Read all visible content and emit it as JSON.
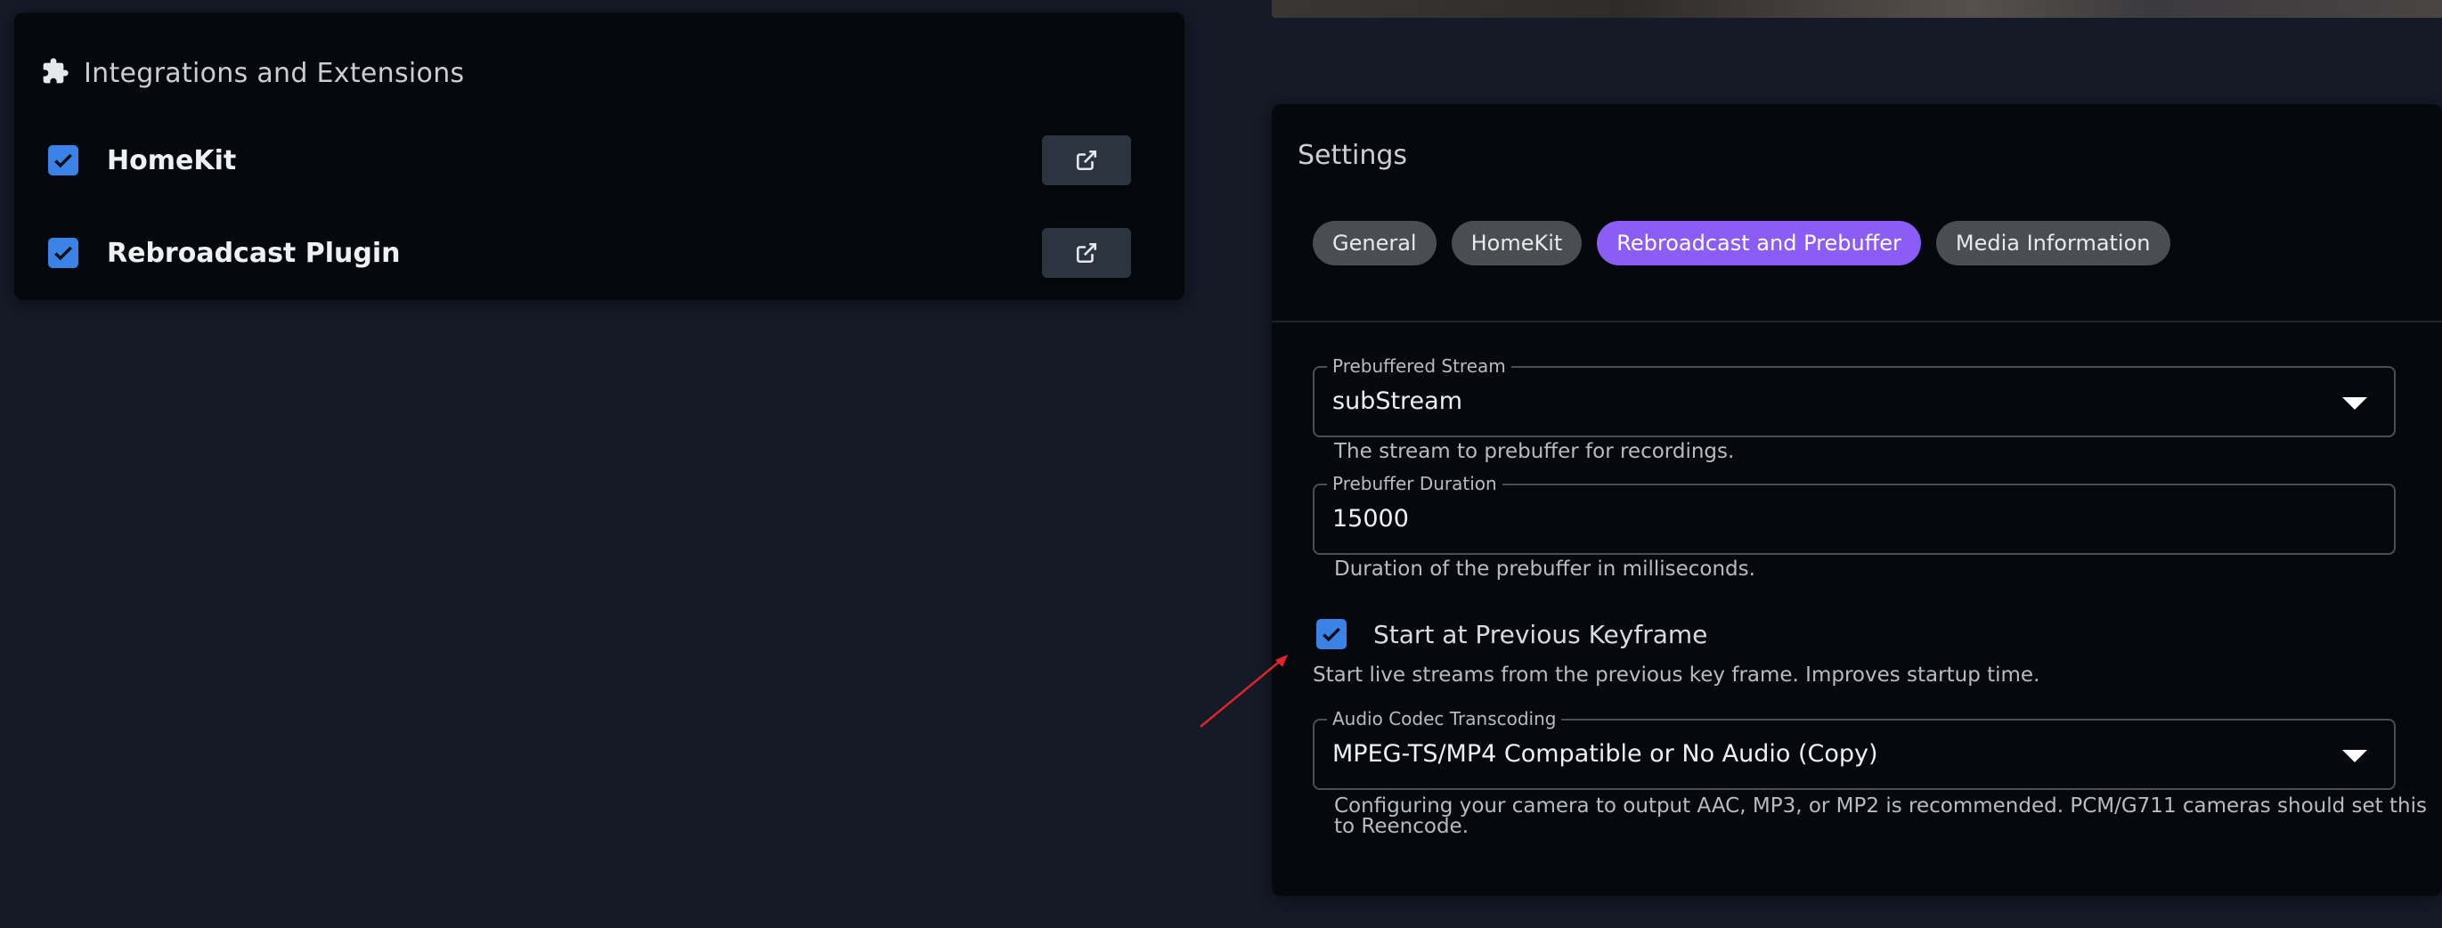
{
  "integrations": {
    "title": "Integrations and Extensions",
    "items": [
      {
        "label": "HomeKit",
        "checked": true
      },
      {
        "label": "Rebroadcast Plugin",
        "checked": true
      }
    ]
  },
  "settings": {
    "title": "Settings",
    "tabs": [
      {
        "label": "General",
        "active": false
      },
      {
        "label": "HomeKit",
        "active": false
      },
      {
        "label": "Rebroadcast and Prebuffer",
        "active": true
      },
      {
        "label": "Media Information",
        "active": false
      }
    ],
    "prebuffered_stream": {
      "legend": "Prebuffered Stream",
      "value": "subStream",
      "helper": "The stream to prebuffer for recordings."
    },
    "prebuffer_duration": {
      "legend": "Prebuffer Duration",
      "value": "15000",
      "helper": "Duration of the prebuffer in milliseconds."
    },
    "keyframe": {
      "label": "Start at Previous Keyframe",
      "checked": true,
      "helper": "Start live streams from the previous key frame. Improves startup time."
    },
    "audio_codec": {
      "legend": "Audio Codec Transcoding",
      "value": "MPEG-TS/MP4 Compatible or No Audio (Copy)",
      "helper_line1": "Configuring your camera to output AAC, MP3, or MP2 is recommended. PCM/G711 cameras should set this",
      "helper_line2": "to Reencode."
    }
  },
  "colors": {
    "background": "#141a26",
    "card": "#05080c",
    "accent_checkbox": "#3b82e6",
    "active_tab": "#8b5cf6",
    "annotation_arrow": "#e0242c"
  },
  "icons": {
    "integrations": "puzzle-icon",
    "external": "external-link-icon",
    "checkbox": "check-icon",
    "dropdown": "caret-down-icon"
  }
}
